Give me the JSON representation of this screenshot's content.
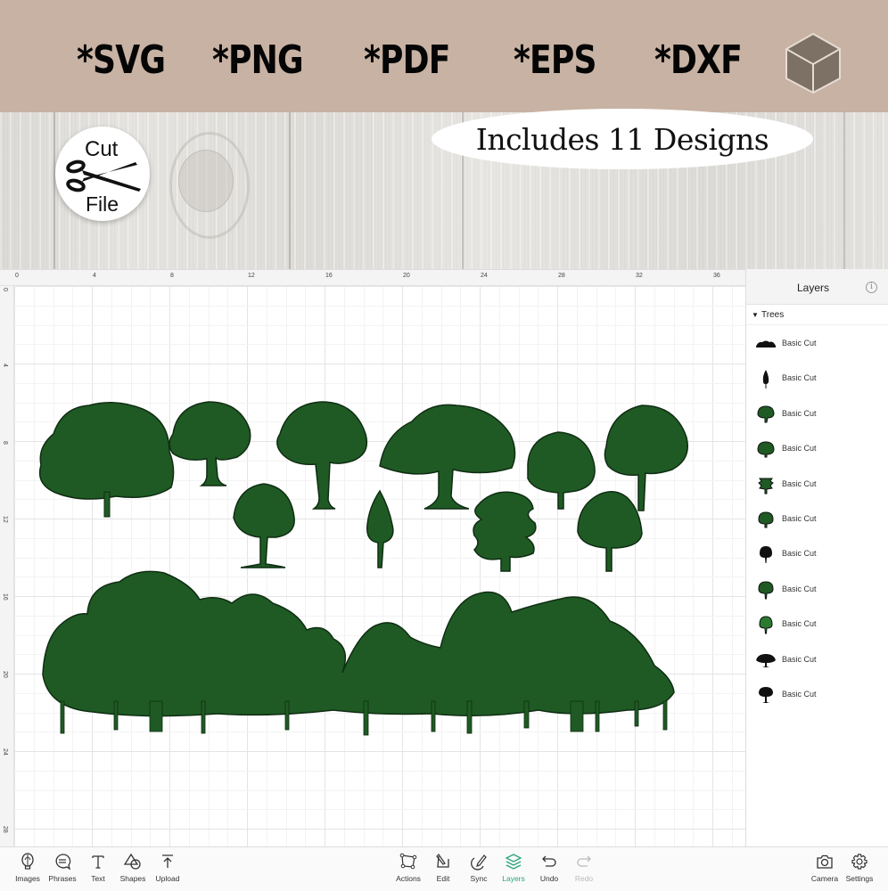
{
  "banner": {
    "formats": [
      "*SVG",
      "*PNG",
      "*PDF",
      "*EPS",
      "*DXF"
    ],
    "badge_line1": "Cut",
    "badge_line2": "File",
    "designs_text": "Includes 11 Designs",
    "bg_color": "#c8b2a3"
  },
  "ruler": {
    "top_labels": [
      "0",
      "4",
      "8",
      "12",
      "16",
      "20",
      "24",
      "28",
      "32",
      "36"
    ],
    "left_labels": [
      "0",
      "4",
      "8",
      "12",
      "16",
      "20",
      "24",
      "28"
    ]
  },
  "canvas": {
    "tree_color": "#1f5a24",
    "tree_count": 12
  },
  "layers_panel": {
    "title": "Layers",
    "group_name": "Trees",
    "items": [
      {
        "label": "Basic Cut",
        "thumb": "forest-row"
      },
      {
        "label": "Basic Cut",
        "thumb": "cypress"
      },
      {
        "label": "Basic Cut",
        "thumb": "oak"
      },
      {
        "label": "Basic Cut",
        "thumb": "bush-tree"
      },
      {
        "label": "Basic Cut",
        "thumb": "layered-pine"
      },
      {
        "label": "Basic Cut",
        "thumb": "round-tree"
      },
      {
        "label": "Basic Cut",
        "thumb": "dark-tree"
      },
      {
        "label": "Basic Cut",
        "thumb": "maple"
      },
      {
        "label": "Basic Cut",
        "thumb": "ash"
      },
      {
        "label": "Basic Cut",
        "thumb": "wide-oak"
      },
      {
        "label": "Basic Cut",
        "thumb": "elm"
      }
    ]
  },
  "toolbar": {
    "left": [
      {
        "label": "Images",
        "icon": "lightbulb-icon"
      },
      {
        "label": "Phrases",
        "icon": "speech-bubble-icon"
      },
      {
        "label": "Text",
        "icon": "text-icon"
      },
      {
        "label": "Shapes",
        "icon": "shapes-icon"
      },
      {
        "label": "Upload",
        "icon": "upload-icon"
      }
    ],
    "center": [
      {
        "label": "Actions",
        "icon": "actions-icon"
      },
      {
        "label": "Edit",
        "icon": "edit-icon"
      },
      {
        "label": "Sync",
        "icon": "sync-icon"
      },
      {
        "label": "Layers",
        "icon": "layers-icon",
        "state": "active"
      },
      {
        "label": "Undo",
        "icon": "undo-icon"
      },
      {
        "label": "Redo",
        "icon": "redo-icon",
        "state": "disabled"
      }
    ],
    "right": [
      {
        "label": "Camera",
        "icon": "camera-icon"
      },
      {
        "label": "Settings",
        "icon": "gear-icon"
      }
    ],
    "active_color": "#2aa57a"
  }
}
